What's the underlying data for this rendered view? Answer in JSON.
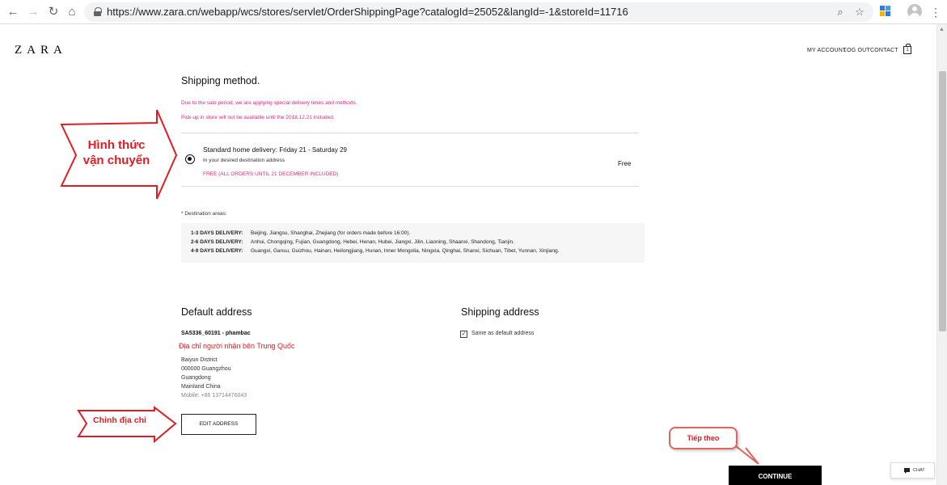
{
  "browser": {
    "url": "https://www.zara.cn/webapp/wcs/stores/servlet/OrderShippingPage?catalogId=25052&langId=-1&storeId=11716",
    "back_glyph": "←",
    "forward_glyph": "→",
    "reload_glyph": "↻",
    "home_glyph": "⌂",
    "zoom_glyph": "⌕",
    "star_glyph": "☆",
    "menu_glyph": "⋮"
  },
  "header": {
    "logo": "ZARA",
    "links": [
      "MY ACCOUNT",
      "LOG OUT",
      "CONTACT"
    ],
    "bag_count": "1"
  },
  "shipping_method": {
    "title": "Shipping method.",
    "notice_1": "Due to the sale period, we are applying special delivery times and methods.",
    "notice_2": "Pick-up in store will not be available until the 2018.12.21 included.",
    "option": {
      "name": "Standard home delivery:",
      "dates": "Friday 21 - Saturday 29",
      "description": "In your desired destination address",
      "promo": "FREE (ALL ORDERS UNTIL 21 DECEMBER INCLUDED)",
      "price": "Free"
    }
  },
  "destination": {
    "label": "* Destination areas:",
    "rows": [
      {
        "label": "1-3 DAYS DELIVERY:",
        "areas": "Beijing, Jiangsu, Shanghai, Zhejiang (for orders made before 16:00)."
      },
      {
        "label": "2-6 DAYS DELIVERY:",
        "areas": "Anhui, Chongqing, Fujian, Guangdong, Hebei, Henan, Hubei, Jiangxi, Jilin, Liaoning, Shaanxi, Shandong, Tianjin."
      },
      {
        "label": "4-9 DAYS DELIVERY:",
        "areas": "Guangxi, Gansu, Guizhou, Hainan, Heilongjiang, Hunan, Inner Mongolia, Ningxia, Qinghai, Shanxi, Sichuan, Tibet, Yunnan, Xinjiang."
      }
    ]
  },
  "default_address": {
    "title": "Default address",
    "name": "SA5336_60191 - phambac",
    "lines": [
      "Baiyun District",
      "000000  Guangzhou",
      "Guangdong",
      "Mainland China"
    ],
    "mobile": "Mobile: +86 13714476043",
    "edit_label": "EDIT ADDRESS"
  },
  "shipping_address": {
    "title": "Shipping address",
    "same_label": "Same as default address",
    "checked_glyph": "✓"
  },
  "actions": {
    "continue_label": "CONTINUE",
    "chat_label": "CHAT"
  },
  "annotations": {
    "shipping_line1": "Hình thức",
    "shipping_line2": "vận chuyển",
    "recipient": "Địa chỉ người nhận bên Trung Quốc",
    "edit": "Chỉnh địa chỉ",
    "next": "Tiếp theo",
    "arrow_fill": "#ffffff",
    "arrow_stroke": "#e21c23"
  }
}
